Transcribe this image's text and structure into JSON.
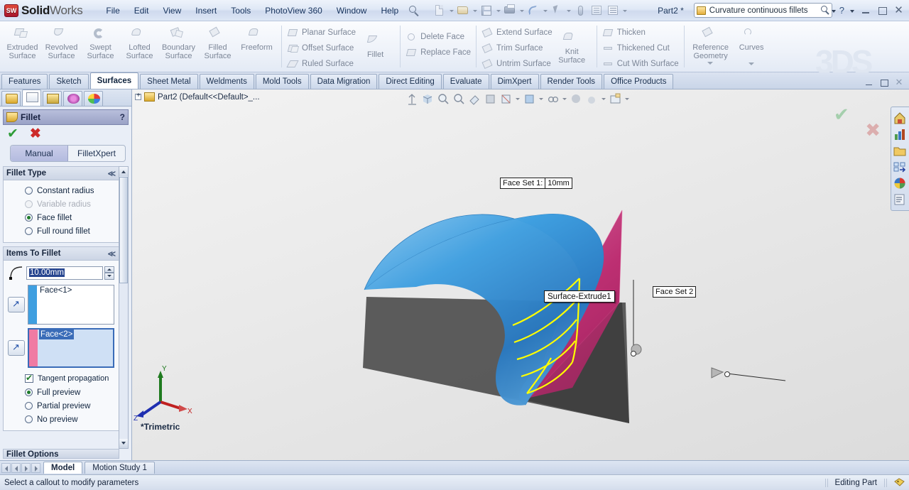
{
  "app": {
    "brand_bold": "Solid",
    "brand_light": "Works",
    "logo_text": "SW",
    "document_title": "Part2 *",
    "watermark": "3DS"
  },
  "menu": {
    "items": [
      "File",
      "Edit",
      "View",
      "Insert",
      "Tools",
      "PhotoView 360",
      "Window",
      "Help"
    ],
    "search_icon": "search-icon"
  },
  "quick_access": [
    {
      "name": "new-document-icon",
      "label": "New"
    },
    {
      "name": "open-document-icon",
      "label": "Open"
    },
    {
      "name": "save-icon",
      "label": "Save"
    },
    {
      "name": "print-icon",
      "label": "Print"
    },
    {
      "name": "undo-icon",
      "label": "Undo"
    },
    {
      "name": "select-icon",
      "label": "Select"
    },
    {
      "name": "rebuild-icon",
      "label": "Rebuild"
    },
    {
      "name": "options-icon",
      "label": "Options"
    },
    {
      "name": "customize-icon",
      "label": "Customize"
    }
  ],
  "search": {
    "value": "Curvature continuous fillets",
    "placeholder": "Search"
  },
  "window_controls": {
    "help": "?",
    "minimize": "minimize",
    "restore": "restore",
    "close": "✕"
  },
  "ribbon": {
    "big_buttons": [
      {
        "label_line1": "Extruded",
        "label_line2": "Surface",
        "icon": "extruded-surface-icon"
      },
      {
        "label_line1": "Revolved",
        "label_line2": "Surface",
        "icon": "revolved-surface-icon"
      },
      {
        "label_line1": "Swept",
        "label_line2": "Surface",
        "icon": "swept-surface-icon"
      },
      {
        "label_line1": "Lofted",
        "label_line2": "Surface",
        "icon": "lofted-surface-icon"
      },
      {
        "label_line1": "Boundary",
        "label_line2": "Surface",
        "icon": "boundary-surface-icon"
      },
      {
        "label_line1": "Filled",
        "label_line2": "Surface",
        "icon": "filled-surface-icon"
      },
      {
        "label_line1": "Freeform",
        "label_line2": "",
        "icon": "freeform-icon"
      }
    ],
    "group_surface_ops": [
      "Planar Surface",
      "Offset Surface",
      "Ruled Surface"
    ],
    "fillet": {
      "label": "Fillet",
      "icon": "fillet-icon"
    },
    "group_face_ops": [
      "Delete Face",
      "Replace Face"
    ],
    "group_edit_surface": [
      "Extend Surface",
      "Trim Surface",
      "Untrim Surface"
    ],
    "knit": {
      "label_line1": "Knit",
      "label_line2": "Surface",
      "icon": "knit-surface-icon"
    },
    "group_thicken": [
      "Thicken",
      "Thickened Cut",
      "Cut With Surface"
    ],
    "reference_geometry": {
      "label_line1": "Reference",
      "label_line2": "Geometry",
      "icon": "reference-geometry-icon"
    },
    "curves": {
      "label_line1": "Curves",
      "label_line2": "",
      "icon": "curves-icon"
    }
  },
  "command_tabs": {
    "active": "Surfaces",
    "items": [
      "Features",
      "Sketch",
      "Surfaces",
      "Sheet Metal",
      "Weldments",
      "Mold Tools",
      "Data Migration",
      "Direct Editing",
      "Evaluate",
      "DimXpert",
      "Render Tools",
      "Office Products"
    ]
  },
  "property_manager": {
    "tabs": [
      {
        "name": "feature-manager-tab",
        "active": false
      },
      {
        "name": "property-manager-tab",
        "active": true
      },
      {
        "name": "configuration-manager-tab",
        "active": false
      },
      {
        "name": "dimxpert-manager-tab",
        "active": false
      },
      {
        "name": "display-manager-tab",
        "active": false
      }
    ],
    "title": "Fillet",
    "title_icon": "fillet-icon",
    "help": "?",
    "ok_label": "✔",
    "cancel_label": "✖",
    "mode_tabs": {
      "manual": "Manual",
      "expert": "FilletXpert",
      "active": "Manual"
    },
    "fillet_type": {
      "header": "Fillet Type",
      "chevron": "≪",
      "options": [
        {
          "label": "Constant radius",
          "selected": false,
          "disabled": false,
          "accel": "C"
        },
        {
          "label": "Variable radius",
          "selected": false,
          "disabled": true,
          "accel": "V"
        },
        {
          "label": "Face fillet",
          "selected": true,
          "disabled": false,
          "accel": "l"
        },
        {
          "label": "Full round fillet",
          "selected": false,
          "disabled": false,
          "accel": "F"
        }
      ]
    },
    "items_to_fillet": {
      "header": "Items To Fillet",
      "chevron": "≪",
      "radius_value": "10.00mm",
      "radius_icon": "radius-icon",
      "face_set_1": {
        "label": "Face<1>",
        "swatch_color": "#3f9fe0",
        "selected": false
      },
      "face_set_2": {
        "label": "Face<2>",
        "swatch_color": "#f07ba3",
        "selected": true
      },
      "tangent_propagation": {
        "label": "Tangent propagation",
        "checked": true
      },
      "preview_options": [
        {
          "label": "Full preview",
          "selected": true
        },
        {
          "label": "Partial preview",
          "selected": false
        },
        {
          "label": "No preview",
          "selected": false
        }
      ]
    },
    "next_section_header": "Fillet Options"
  },
  "feature_tree": {
    "expand": "+",
    "label": "Part2  (Default<<Default>_...",
    "icon": "part-icon"
  },
  "view_toolbar": [
    {
      "name": "zoom-to-fit-icon"
    },
    {
      "name": "view-orientation-icon"
    },
    {
      "name": "zoom-to-area-icon"
    },
    {
      "name": "previous-view-icon"
    },
    {
      "name": "section-view-icon"
    },
    {
      "name": "view-orientation-cube-icon"
    },
    {
      "name": "display-style-icon"
    },
    {
      "name": "hide-show-items-icon"
    },
    {
      "name": "edit-appearance-icon"
    },
    {
      "name": "apply-scene-icon"
    },
    {
      "name": "view-settings-icon"
    }
  ],
  "viewport": {
    "callout_face_set_1": {
      "label": "Face Set 1:",
      "value": "10mm"
    },
    "callout_face_set_2": {
      "label": "Face Set 2"
    },
    "tooltip": "Surface-Extrude1",
    "orientation_label": "*Trimetric",
    "triad": {
      "x": "X",
      "y": "Y",
      "z": "Z"
    },
    "colors": {
      "face_set_1": "#3f9fe0",
      "face_set_2": "#c0377a",
      "preview_curves": "#ffff00",
      "shadow": "#3a3a3a"
    }
  },
  "confirmation_corner": {
    "accept": "✔",
    "cancel": "✖"
  },
  "task_pane": [
    {
      "name": "sw-resources-icon"
    },
    {
      "name": "design-library-icon"
    },
    {
      "name": "file-explorer-icon"
    },
    {
      "name": "view-palette-icon"
    },
    {
      "name": "appearances-scenes-icon"
    },
    {
      "name": "custom-properties-icon"
    }
  ],
  "bottom_tabs": {
    "active": "Model",
    "items": [
      "Model",
      "Motion Study 1"
    ]
  },
  "status_bar": {
    "message": "Select a callout to modify parameters",
    "right_text": "Editing Part",
    "tag_icon": "tag-icon"
  }
}
